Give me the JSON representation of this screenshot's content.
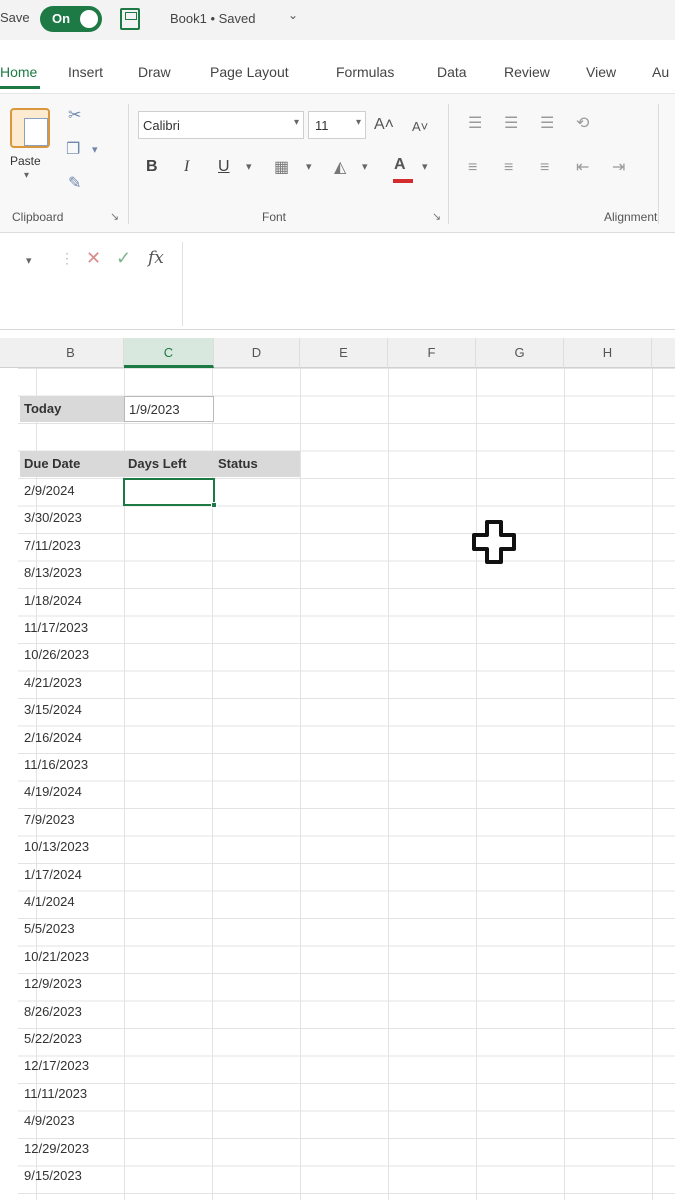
{
  "titlebar": {
    "autosave_label": "Save",
    "autosave_state": "On",
    "doc_title": "Book1 • Saved",
    "title_chevron": "⌄"
  },
  "tabs": [
    {
      "label": "Home",
      "active": true
    },
    {
      "label": "Insert"
    },
    {
      "label": "Draw"
    },
    {
      "label": "Page Layout"
    },
    {
      "label": "Formulas"
    },
    {
      "label": "Data"
    },
    {
      "label": "Review"
    },
    {
      "label": "View"
    },
    {
      "label": "Au"
    }
  ],
  "ribbon": {
    "paste_label": "Paste",
    "clipboard_label": "Clipboard",
    "font_label": "Font",
    "alignment_label": "Alignment",
    "font_name": "Calibri",
    "font_size": "11",
    "bold": "B",
    "italic": "I",
    "underline": "U",
    "increase_font": "A",
    "decrease_font": "A",
    "font_color_letter": "A",
    "accent_color": "#1e7a45",
    "font_color": "#d22c2c"
  },
  "formula_bar": {
    "cancel": "✕",
    "enter": "✓",
    "fx": "fx",
    "value": ""
  },
  "columns": [
    "B",
    "C",
    "D",
    "E",
    "F",
    "G",
    "H"
  ],
  "sheet": {
    "today_label": "Today",
    "today_value": "1/9/2023",
    "headers": [
      "Due Date",
      "Days Left",
      "Status"
    ],
    "due_dates": [
      "2/9/2024",
      "3/30/2023",
      "7/11/2023",
      "8/13/2023",
      "1/18/2024",
      "11/17/2023",
      "10/26/2023",
      "4/21/2023",
      "3/15/2024",
      "2/16/2024",
      "11/16/2023",
      "4/19/2024",
      "7/9/2023",
      "10/13/2023",
      "1/17/2024",
      "4/1/2024",
      "5/5/2023",
      "10/21/2023",
      "12/9/2023",
      "8/26/2023",
      "5/22/2023",
      "12/17/2023",
      "11/11/2023",
      "4/9/2023",
      "12/29/2023",
      "9/15/2023"
    ]
  }
}
